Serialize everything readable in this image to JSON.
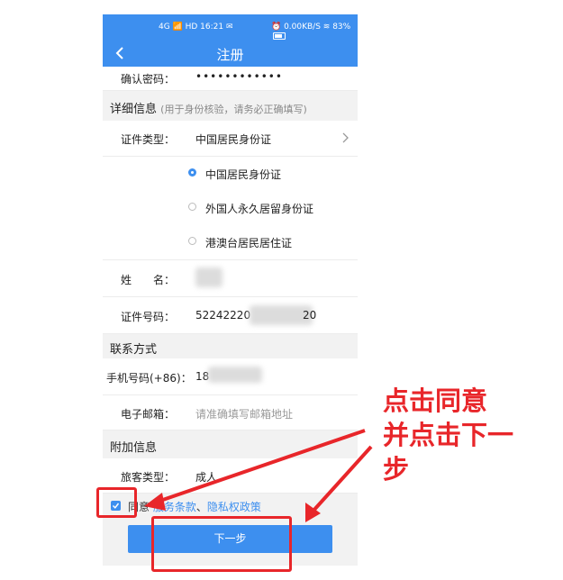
{
  "statusbar": {
    "left": "4G 📶 HD 16:21 ✉",
    "right": "⏰ 0.00KB/S ≋ 83%"
  },
  "navbar": {
    "title": "注册"
  },
  "rows": {
    "confirm_password": {
      "label": "确认密码：",
      "value": "••••••••••••"
    },
    "details_section": {
      "title": "详细信息",
      "hint": "(用于身份核验，请务必正确填写)"
    },
    "id_type": {
      "label": "证件类型：",
      "value": "中国居民身份证"
    },
    "id_options": [
      "中国居民身份证",
      "外国人永久居留身份证",
      "港澳台居民居住证"
    ],
    "name": {
      "label": "姓　　名："
    },
    "id_number": {
      "label": "证件号码：",
      "value_start": "52242220",
      "value_end": "20"
    },
    "contact_section": {
      "title": "联系方式"
    },
    "phone": {
      "label": "手机号码(+86)：",
      "value_start": "18"
    },
    "email": {
      "label": "电子邮箱：",
      "placeholder": "请准确填写邮箱地址"
    },
    "extra_section": {
      "title": "附加信息"
    },
    "passenger_type": {
      "label": "旅客类型：",
      "value": "成人"
    }
  },
  "agree": {
    "prefix": "同意",
    "link1": "服务条款",
    "sep": "、",
    "link2": "隐私权政策",
    "checked": true
  },
  "next_button": {
    "label": "下一步"
  },
  "annotation": {
    "line1": "点击同意",
    "line2": "并点击下一",
    "line3": "步"
  },
  "colors": {
    "primary": "#3d8fef",
    "annotation": "#e8262a"
  }
}
